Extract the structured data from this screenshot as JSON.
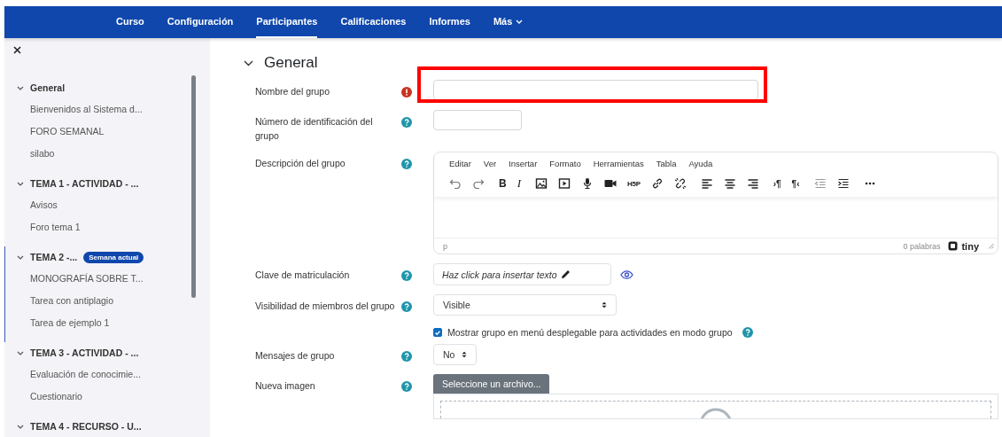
{
  "nav": {
    "items": [
      {
        "label": "Curso",
        "selected": false,
        "dropdown": false
      },
      {
        "label": "Configuración",
        "selected": false,
        "dropdown": false
      },
      {
        "label": "Participantes",
        "selected": true,
        "dropdown": false
      },
      {
        "label": "Calificaciones",
        "selected": false,
        "dropdown": false
      },
      {
        "label": "Informes",
        "selected": false,
        "dropdown": false
      },
      {
        "label": "Más",
        "selected": false,
        "dropdown": true
      }
    ]
  },
  "sidebar": {
    "sections": [
      {
        "title": "General",
        "expanded": true,
        "current": false,
        "items": [
          "Bienvenidos al Sistema d...",
          "FORO SEMANAL",
          "silabo"
        ]
      },
      {
        "title": "TEMA 1 - ACTIVIDAD - ...",
        "expanded": true,
        "current": false,
        "items": [
          "Avisos",
          "Foro tema 1"
        ]
      },
      {
        "title": "TEMA 2 -...",
        "expanded": true,
        "current": true,
        "badge": "Semana actual",
        "items": [
          "MONOGRAFÍA SOBRE T...",
          "Tarea con antiplagio",
          "Tarea de ejemplo 1"
        ]
      },
      {
        "title": "TEMA 3 - ACTIVIDAD - ...",
        "expanded": true,
        "current": false,
        "items": [
          "Evaluación de conocimie...",
          "Cuestionario"
        ]
      },
      {
        "title": "TEMA 4 - RECURSO - U...",
        "expanded": true,
        "current": false
      }
    ]
  },
  "form": {
    "title": "General",
    "expanded": true,
    "fields": [
      {
        "kind": "longtext",
        "label": "Nombre del grupo",
        "required": true,
        "highlighted": true
      },
      {
        "kind": "shorttext",
        "label": "Número de identificación del grupo",
        "required": false,
        "highlighted": false
      },
      {
        "kind": "editor",
        "label": "Descripción del grupo",
        "required": false,
        "highlighted": false,
        "menu": [
          "Editar",
          "Ver",
          "Insertar",
          "Formato",
          "Herramientas",
          "Tabla",
          "Ayuda"
        ],
        "toolbar_text": {
          "bold": "B",
          "italic": "I",
          "h5p": "H5P",
          "ltr": "›¶",
          "rtl": "¶‹"
        },
        "path": "p",
        "word_count": "0 palabras",
        "brand": "tiny"
      },
      {
        "kind": "inline",
        "label": "Clave de matriculación",
        "required": false,
        "highlighted": false,
        "value": "Haz click para insertar texto"
      },
      {
        "kind": "select",
        "label": "Visibilidad de miembros del grupo",
        "required": false,
        "highlighted": false,
        "value": "Visible"
      },
      {
        "kind": "checkbox",
        "text": "Mostrar grupo en menú desplegable para actividades en modo grupo",
        "checked": true,
        "required": false,
        "highlighted": false
      },
      {
        "kind": "compactselect",
        "label": "Mensajes de grupo",
        "required": false,
        "highlighted": false,
        "value": "No"
      },
      {
        "kind": "file",
        "label": "Nueva imagen",
        "required": false,
        "highlighted": false,
        "button": "Seleccione un archivo..."
      }
    ]
  }
}
